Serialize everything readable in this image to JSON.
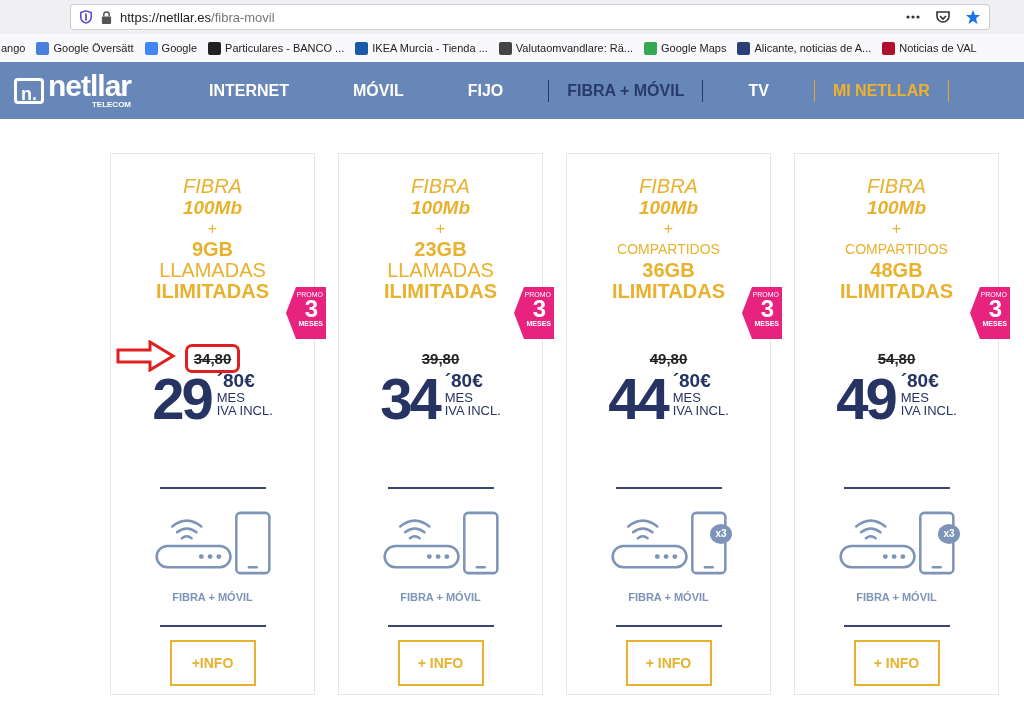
{
  "browser": {
    "url_host": "https://netllar.es",
    "url_path": "/fibra-movil",
    "bookmarks": [
      {
        "label": "ango"
      },
      {
        "label": "Google Översätt"
      },
      {
        "label": "Google"
      },
      {
        "label": "Particulares - BANCO ..."
      },
      {
        "label": "IKEA Murcia - Tienda ..."
      },
      {
        "label": "Valutaomvandlare: Rä..."
      },
      {
        "label": "Google Maps"
      },
      {
        "label": "Alicante, noticias de A..."
      },
      {
        "label": "Noticias de VAL"
      }
    ]
  },
  "nav": {
    "logo": "netllar",
    "logo_sub": "TELECOM",
    "logo_mark": "n.",
    "items": [
      {
        "label": "INTERNET",
        "selected": false,
        "kind": "link"
      },
      {
        "label": "MÓVIL",
        "selected": false,
        "kind": "link"
      },
      {
        "label": "FIJO",
        "selected": false,
        "kind": "link"
      },
      {
        "label": "FIBRA + MÓVIL",
        "selected": true,
        "kind": "link"
      },
      {
        "label": "TV",
        "selected": false,
        "kind": "link"
      },
      {
        "label": "MI NETLLAR",
        "selected": false,
        "kind": "account"
      }
    ]
  },
  "plans": [
    {
      "lines": [
        {
          "text": "FIBRA",
          "kind": "italic"
        },
        {
          "text": "100Mb",
          "kind": "strong-italic"
        },
        {
          "text": "+",
          "kind": "plus"
        },
        {
          "text": "9GB",
          "kind": "strong"
        },
        {
          "text": "LLAMADAS",
          "kind": "light"
        },
        {
          "text": "ILIMITADAS",
          "kind": "strong"
        }
      ],
      "promo": {
        "top": "PROMO",
        "number": "3",
        "bottom": "MESES"
      },
      "old_price": "34,80",
      "highlighted": true,
      "price": "29",
      "cents": "´80€",
      "period": "MES",
      "tax": "IVA INCL.",
      "service": "FIBRA + MÓVIL",
      "button": "+INFO"
    },
    {
      "lines": [
        {
          "text": "FIBRA",
          "kind": "italic"
        },
        {
          "text": "100Mb",
          "kind": "strong-italic"
        },
        {
          "text": "+",
          "kind": "plus"
        },
        {
          "text": "23GB",
          "kind": "strong"
        },
        {
          "text": "LLAMADAS",
          "kind": "light"
        },
        {
          "text": "ILIMITADAS",
          "kind": "strong"
        }
      ],
      "promo": {
        "top": "PROMO",
        "number": "3",
        "bottom": "MESES"
      },
      "old_price": "39,80",
      "highlighted": false,
      "price": "34",
      "cents": "´80€",
      "period": "MES",
      "tax": "IVA INCL.",
      "service": "FIBRA + MÓVIL",
      "button": "+ INFO"
    },
    {
      "lines": [
        {
          "text": "FIBRA",
          "kind": "italic"
        },
        {
          "text": "100Mb",
          "kind": "strong-italic"
        },
        {
          "text": "+",
          "kind": "plus"
        },
        {
          "text": "COMPARTIDOS",
          "kind": "small-light"
        },
        {
          "text": "36GB",
          "kind": "strong"
        },
        {
          "text": "ILIMITADAS",
          "kind": "strong"
        }
      ],
      "promo": {
        "top": "PROMO",
        "number": "3",
        "bottom": "MESES"
      },
      "old_price": "49,80",
      "highlighted": false,
      "price": "44",
      "cents": "´80€",
      "period": "MES",
      "tax": "IVA INCL.",
      "shared_badge": "x3",
      "service": "FIBRA + MÓVIL",
      "button": "+ INFO"
    },
    {
      "lines": [
        {
          "text": "FIBRA",
          "kind": "italic"
        },
        {
          "text": "100Mb",
          "kind": "strong-italic"
        },
        {
          "text": "+",
          "kind": "plus"
        },
        {
          "text": "COMPARTIDOS",
          "kind": "small-light"
        },
        {
          "text": "48GB",
          "kind": "strong"
        },
        {
          "text": "ILIMITADAS",
          "kind": "strong"
        }
      ],
      "promo": {
        "top": "PROMO",
        "number": "3",
        "bottom": "MESES"
      },
      "old_price": "54,80",
      "highlighted": false,
      "price": "49",
      "cents": "´80€",
      "period": "MES",
      "tax": "IVA INCL.",
      "shared_badge": "x3",
      "service": "FIBRA + MÓVIL",
      "button": "+ INFO"
    }
  ]
}
